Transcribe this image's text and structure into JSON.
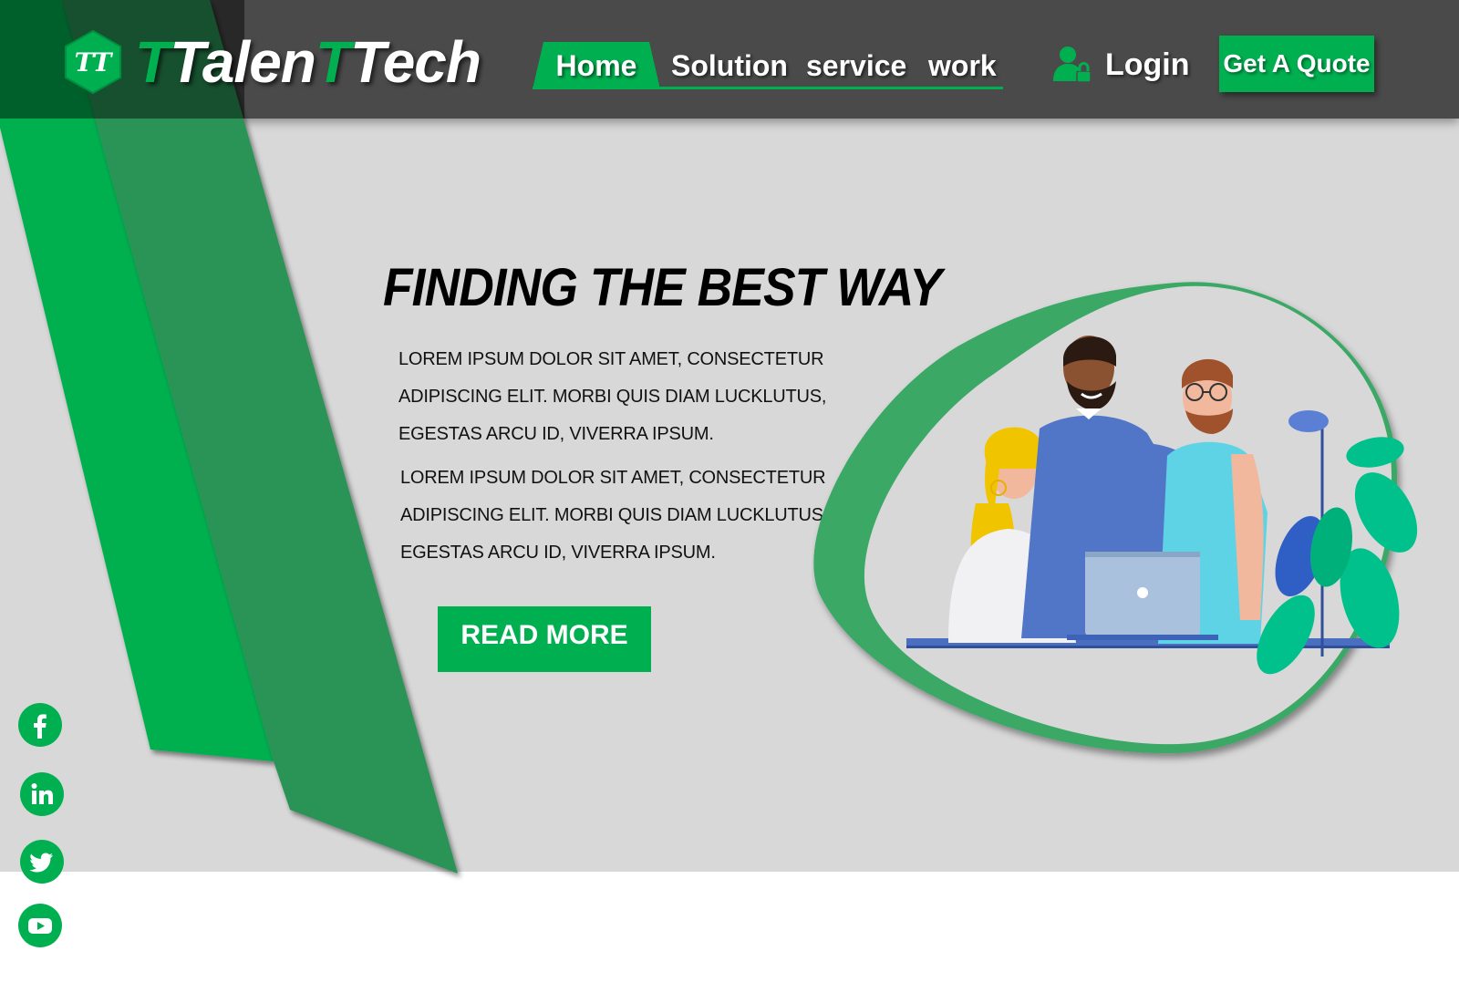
{
  "brand": {
    "monogram": "TT",
    "name_part1": "Talen",
    "name_part2": "Tech",
    "accent_color": "#00b050",
    "header_color": "#4a4a4a"
  },
  "nav": {
    "items": [
      {
        "label": "Home",
        "active": true
      },
      {
        "label": "Solution",
        "active": false
      },
      {
        "label": "service",
        "active": false
      },
      {
        "label": "work",
        "active": false
      }
    ]
  },
  "login": {
    "label": "Login",
    "icon": "user-lock-icon"
  },
  "quote": {
    "label": "Get A Quote"
  },
  "hero": {
    "headline": "FINDING THE BEST WAY",
    "paragraphs": [
      [
        "LOREM IPSUM DOLOR SIT AMET, CONSECTETUR",
        "ADIPISCING ELIT. MORBI QUIS DIAM LUCKLUTUS,",
        "EGESTAS ARCU ID, VIVERRA IPSUM."
      ],
      [
        "LOREM IPSUM DOLOR SIT AMET, CONSECTETUR",
        "ADIPISCING ELIT. MORBI QUIS DIAM LUCKLUTUS,",
        "EGESTAS ARCU ID, VIVERRA IPSUM."
      ]
    ],
    "cta_label": "READ MORE",
    "illustration": "team-at-laptop-illustration"
  },
  "social": [
    {
      "icon": "facebook-icon"
    },
    {
      "icon": "linkedin-icon"
    },
    {
      "icon": "twitter-icon"
    },
    {
      "icon": "youtube-icon"
    }
  ]
}
